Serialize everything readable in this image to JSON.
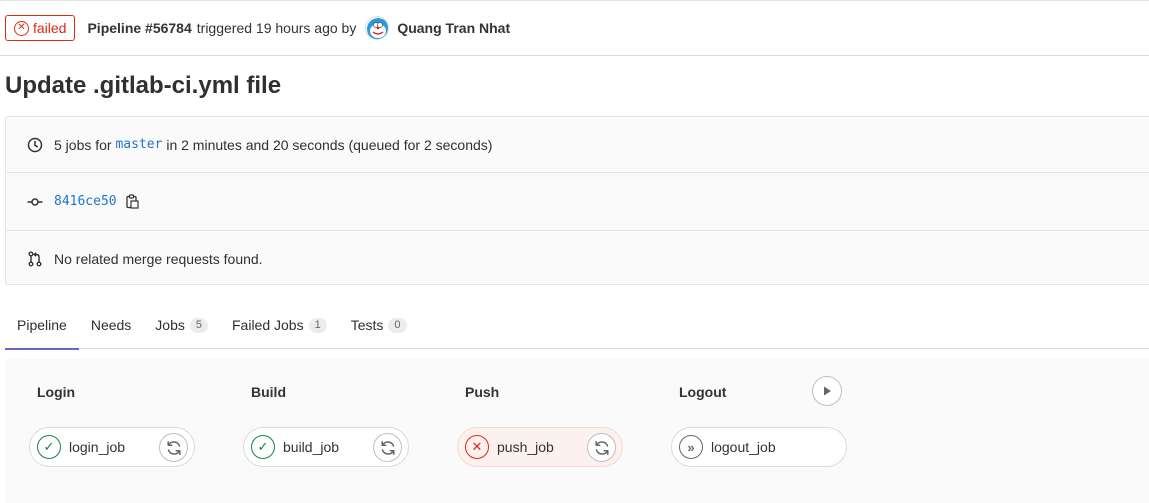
{
  "header": {
    "status": "failed",
    "pipeline_id": "Pipeline #56784",
    "triggered_text": "triggered 19 hours ago by",
    "author": "Quang Tran Nhat"
  },
  "title": "Update .gitlab-ci.yml file",
  "info": {
    "jobs_prefix": "5 jobs for",
    "branch": "master",
    "jobs_suffix": "in 2 minutes and 20 seconds (queued for 2 seconds)",
    "commit_sha": "8416ce50",
    "merge_requests": "No related merge requests found."
  },
  "tabs": [
    {
      "label": "Pipeline",
      "count": null
    },
    {
      "label": "Needs",
      "count": null
    },
    {
      "label": "Jobs",
      "count": "5"
    },
    {
      "label": "Failed Jobs",
      "count": "1"
    },
    {
      "label": "Tests",
      "count": "0"
    }
  ],
  "stages": [
    {
      "title": "Login",
      "job": "login_job",
      "status": "success"
    },
    {
      "title": "Build",
      "job": "build_job",
      "status": "success"
    },
    {
      "title": "Push",
      "job": "push_job",
      "status": "failed"
    },
    {
      "title": "Logout",
      "job": "logout_job",
      "status": "manual"
    }
  ],
  "colors": {
    "failed": "#dd2b0e",
    "success": "#108548",
    "link": "#1f75cb",
    "active_tab": "#6666c4"
  },
  "icons": {
    "status": "close-circle-icon",
    "duration": "clock-icon",
    "commit": "commit-icon",
    "copy": "clipboard-icon",
    "merge_request": "merge-request-icon",
    "retry": "retry-icon",
    "play": "play-icon"
  }
}
